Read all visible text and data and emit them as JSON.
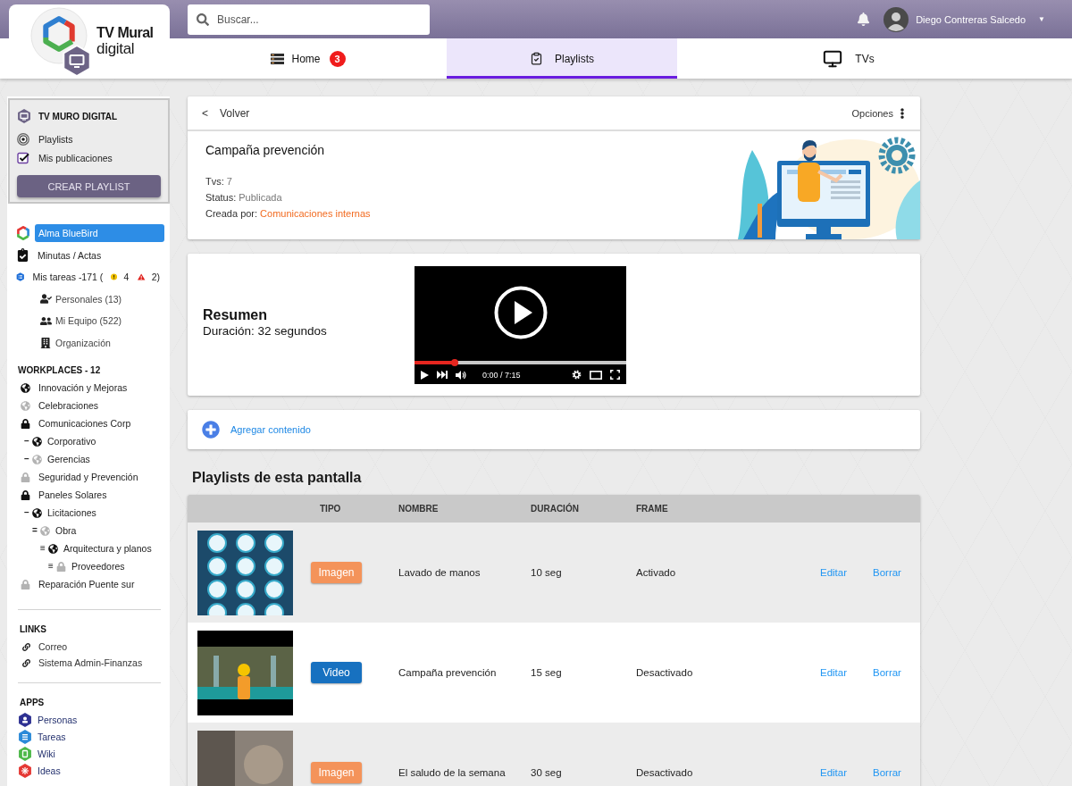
{
  "header": {
    "logo": {
      "title": "TV Mural",
      "subtitle": "digital"
    },
    "search": {
      "placeholder": "Buscar..."
    },
    "user": {
      "name": "Diego Contreras Salcedo",
      "caret": "▼"
    }
  },
  "tabs": [
    {
      "label": "Home",
      "kind": "home",
      "badge": "3",
      "selected": false
    },
    {
      "label": "Playlists",
      "kind": "playlists",
      "selected": true
    },
    {
      "label": "TVs",
      "kind": "tvs",
      "selected": false
    }
  ],
  "sidebar": {
    "panel": {
      "title": "TV MURO DIGITAL",
      "items": [
        {
          "label": "Playlists",
          "kind": "target"
        },
        {
          "label": "Mis publicaciones",
          "kind": "check"
        }
      ],
      "button": "CREAR PLAYLIST"
    },
    "nav": [
      {
        "label": "Alma BlueBird",
        "kind": "bluebird",
        "selected": true
      },
      {
        "label": "Minutas / Actas",
        "kind": "minutes",
        "selected": false
      },
      {
        "label": "Mis tareas -171 (",
        "kind": "tasks",
        "selected": false,
        "warning_count": "4",
        "alert_count": "2)",
        "children": [
          {
            "label": "Personales (13)",
            "kind": "personal",
            "selected": false
          },
          {
            "label": "Mi Equipo (522)",
            "kind": "team",
            "selected": false
          },
          {
            "label": "Organización",
            "kind": "organization",
            "selected": false
          }
        ]
      }
    ],
    "workplaces": {
      "title": "WORKPLACES - 12",
      "items": [
        {
          "label": "Innovación y Mejoras",
          "kind": "globe",
          "dimmed": false
        },
        {
          "label": "Celebraciones",
          "kind": "globe",
          "dimmed": true
        },
        {
          "label": "Comunicaciones Corp",
          "kind": "lock",
          "dimmed": false,
          "children": [
            {
              "marker": "–",
              "label": "Corporativo",
              "kind": "globe",
              "dimmed": false
            },
            {
              "marker": "–",
              "label": "Gerencias",
              "kind": "globe",
              "dimmed": true
            }
          ]
        },
        {
          "label": "Seguridad y Prevención",
          "kind": "lock",
          "dimmed": true
        },
        {
          "label": "Paneles Solares",
          "kind": "lock",
          "dimmed": false,
          "children": [
            {
              "marker": "–",
              "label": "Licitaciones",
              "kind": "globe",
              "dimmed": false,
              "children": [
                {
                  "marker": "=",
                  "label": "Obra",
                  "kind": "globe",
                  "dimmed": true,
                  "children": [
                    {
                      "marker": "≡",
                      "label": "Arquitectura y planos",
                      "kind": "globe",
                      "dimmed": false,
                      "children": [
                        {
                          "marker": "≡",
                          "label": "Proveedores",
                          "kind": "lock",
                          "dimmed": true
                        }
                      ]
                    }
                  ]
                }
              ]
            }
          ]
        },
        {
          "label": "Reparación Puente sur",
          "kind": "lock",
          "dimmed": true
        }
      ]
    },
    "links": {
      "title": "LINKS",
      "items": [
        "Correo",
        "Sistema Admin-Finanzas"
      ]
    },
    "apps": {
      "title": "APPS",
      "items": [
        {
          "label": "Personas",
          "kind": "person",
          "color": "#2e3192"
        },
        {
          "label": "Tareas",
          "kind": "tasks",
          "color": "#2b8ad8"
        },
        {
          "label": "Wiki",
          "kind": "doc",
          "color": "#4cb848"
        },
        {
          "label": "Ideas",
          "kind": "idea",
          "color": "#e53935"
        }
      ]
    }
  },
  "detail": {
    "back": {
      "symbol": "<",
      "label": "Volver"
    },
    "options": "Opciones",
    "title": "Campaña prevención",
    "fields": [
      {
        "label": "Tvs:",
        "value": "7",
        "kind": "text"
      },
      {
        "label": "Status:",
        "value": "Publicada",
        "kind": "text"
      },
      {
        "label": "Creada por:",
        "value": "Comunicaciones internas",
        "kind": "link"
      }
    ]
  },
  "summary": {
    "title": "Resumen",
    "duration": "Duración: 32 segundos",
    "player": {
      "time": "0:00 / 7:15",
      "level": 0.19
    }
  },
  "add_content": {
    "label": "Agregar contenido"
  },
  "playlists": {
    "title": "Playlists de esta pantalla",
    "columns": [
      "TIPO",
      "NOMBRE",
      "DURACIÓN",
      "FRAME"
    ],
    "rows": [
      {
        "thumbnail": {
          "kind": "illustration"
        },
        "type": "Imagen",
        "kind": "image",
        "name": "Lavado de manos",
        "duration": "10 seg",
        "frame": "Activado",
        "edit": "Editar",
        "delete": "Borrar"
      },
      {
        "thumbnail": {
          "kind": "video"
        },
        "type": "Video",
        "kind": "video",
        "name": "Campaña prevención",
        "duration": "15 seg",
        "frame": "Desactivado",
        "edit": "Editar",
        "delete": "Borrar"
      },
      {
        "thumbnail": {
          "kind": "photo"
        },
        "type": "Imagen",
        "kind": "image",
        "name": "El saludo de la semana",
        "duration": "30 seg",
        "frame": "Desactivado",
        "edit": "Editar",
        "delete": "Borrar"
      }
    ]
  }
}
